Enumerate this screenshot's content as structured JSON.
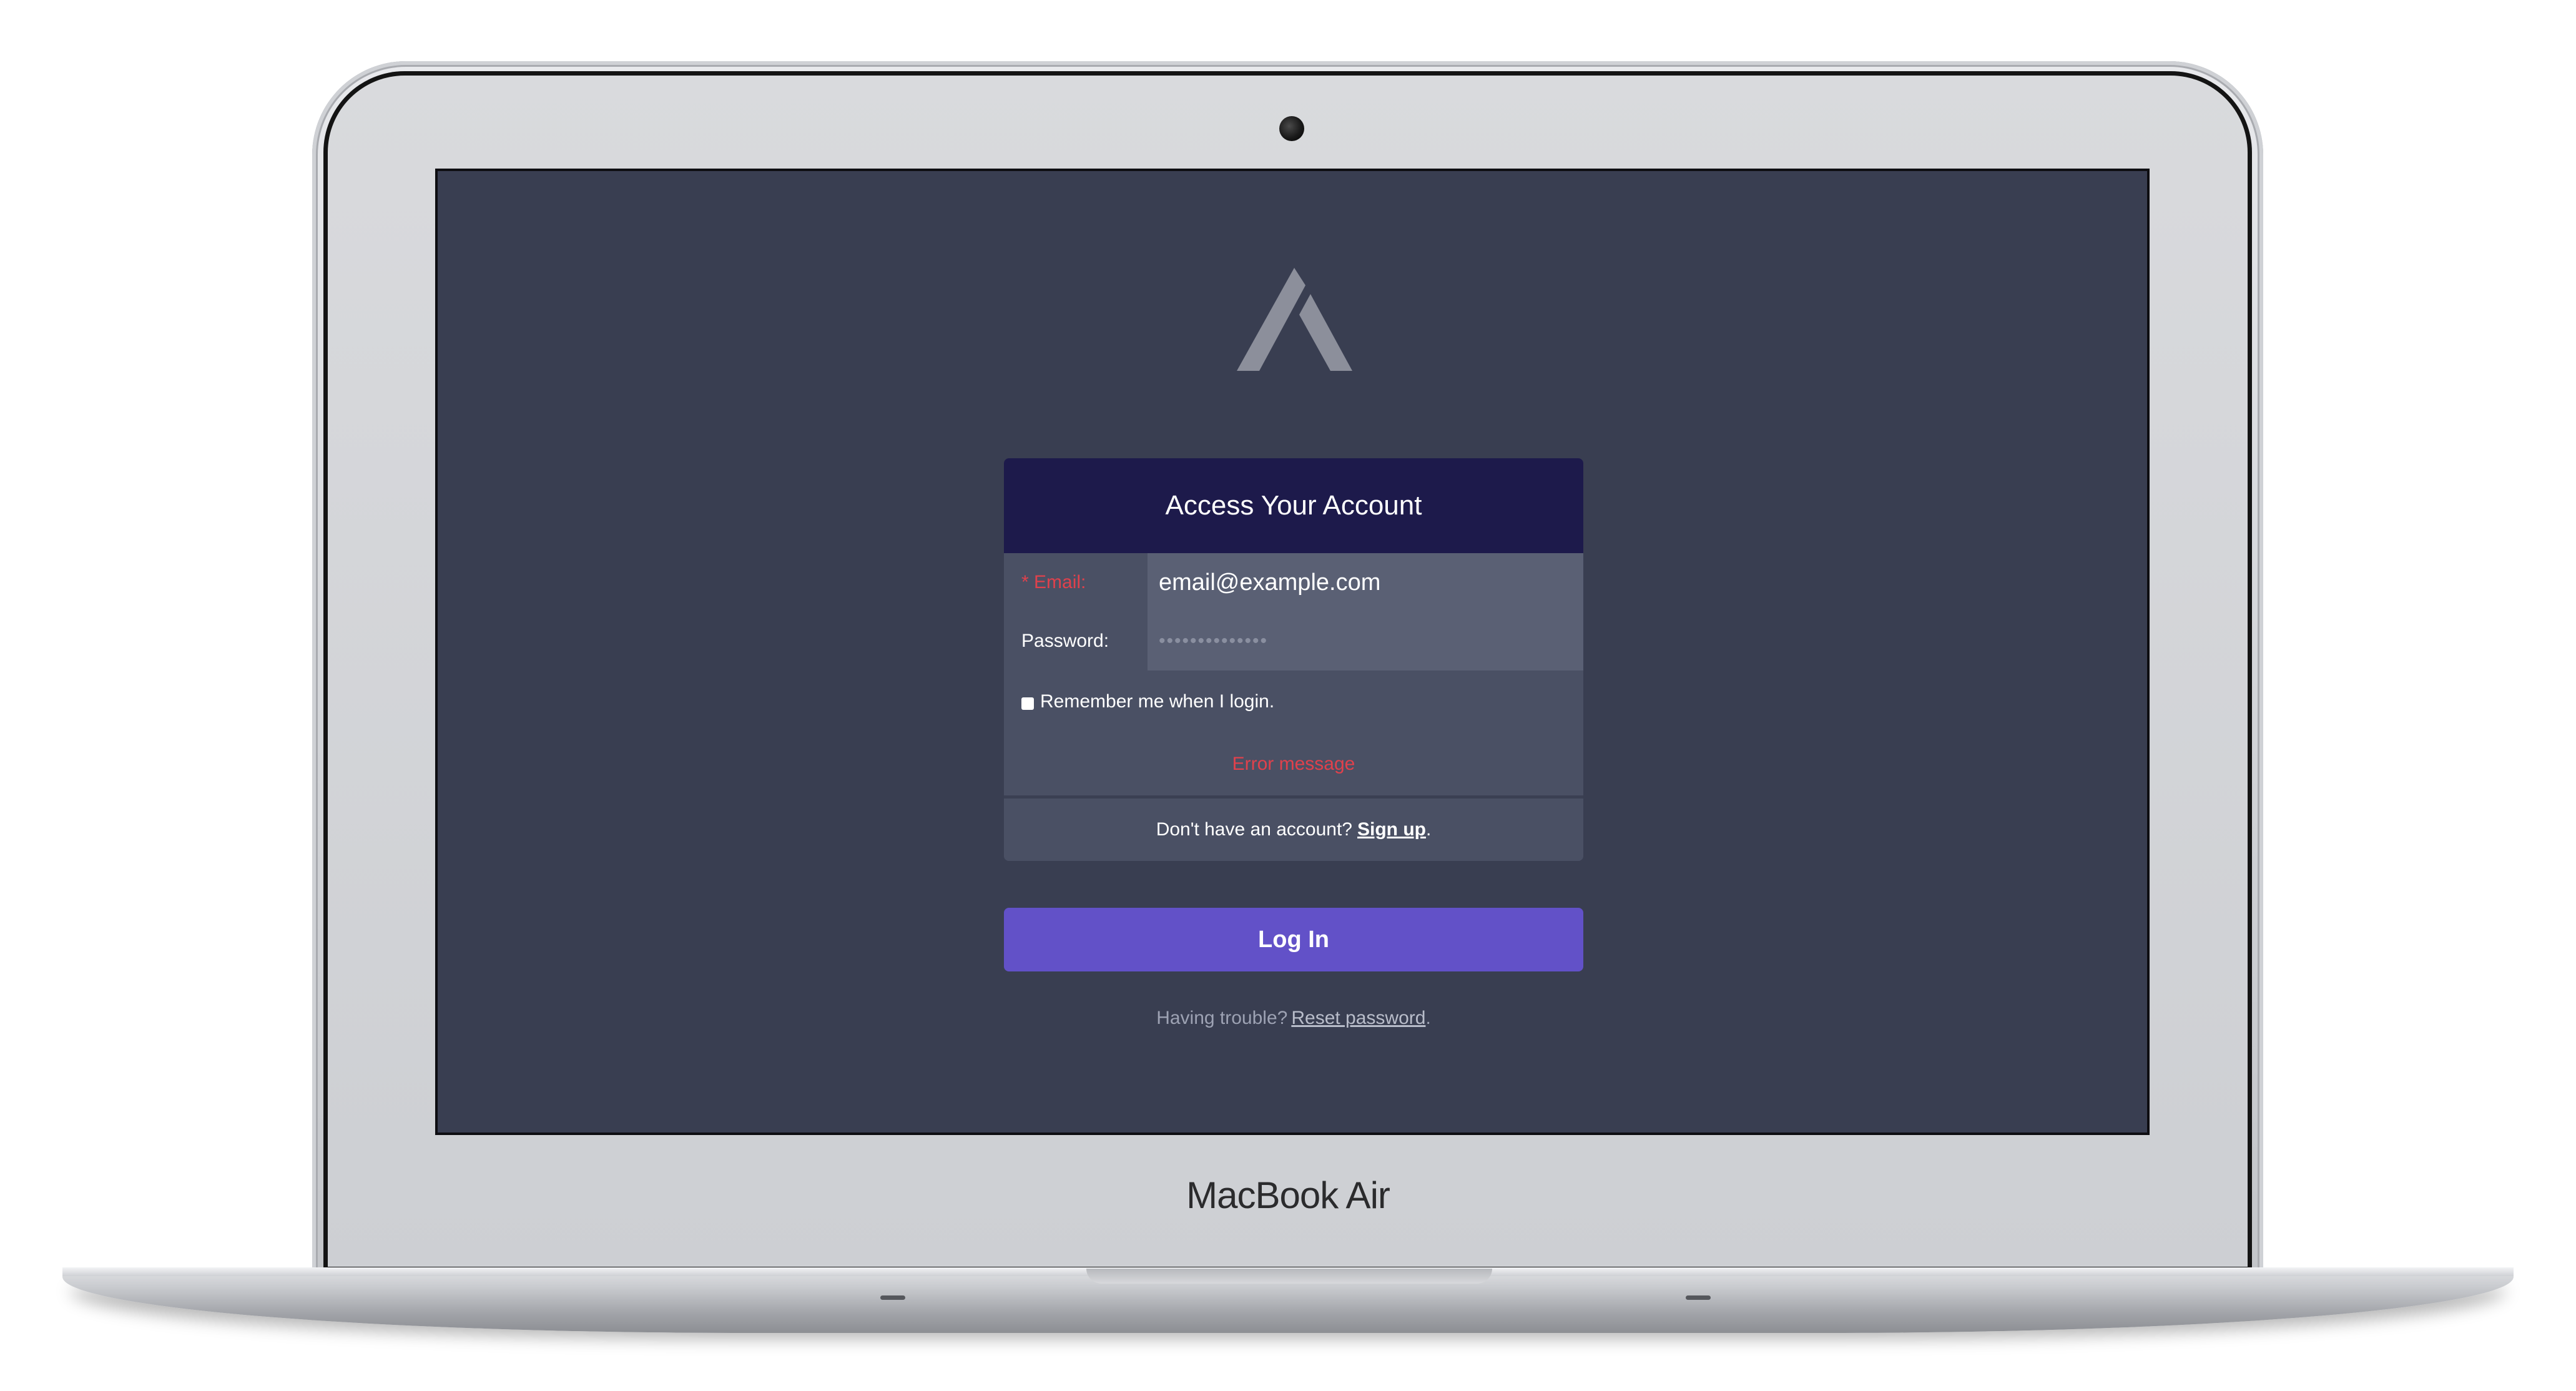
{
  "device": {
    "brand_label": "MacBook Air"
  },
  "login": {
    "title": "Access Your Account",
    "email_label": "* Email:",
    "email_value": "email@example.com",
    "password_label": "Password:",
    "password_value": "••••••••••••••",
    "remember_label": "Remember me when I login.",
    "remember_checked": false,
    "error_message": "Error message",
    "signup_prompt": "Don't have an account?",
    "signup_link": "Sign up",
    "signup_suffix": ".",
    "login_button": "Log In",
    "trouble_prompt": "Having trouble?",
    "reset_link": "Reset password",
    "reset_suffix": "."
  },
  "colors": {
    "screen_bg": "#393e51",
    "header_bg": "#1d1a4b",
    "button_bg": "#6251c8",
    "error": "#e0414c"
  }
}
